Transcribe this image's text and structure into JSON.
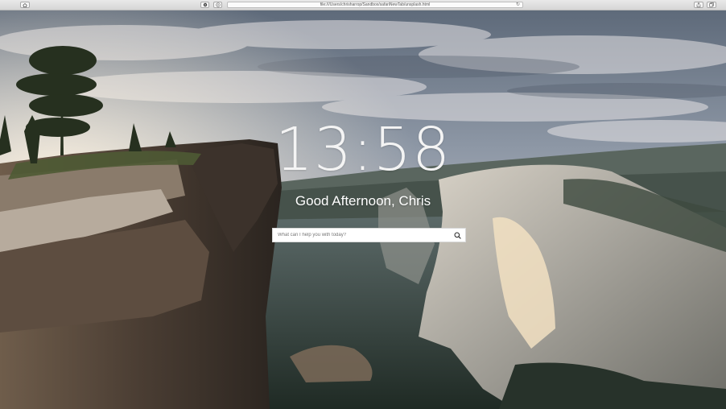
{
  "browser": {
    "url": "file:///Users/chrisharrop/Sandbox/safariNewTab/unsplash.html",
    "icons": {
      "home": "home-icon",
      "settings": "gear-icon",
      "extension": "compass-icon",
      "reload": "reload-icon",
      "share": "share-icon",
      "tabs": "tabs-icon"
    }
  },
  "page": {
    "time": "13:58",
    "greeting": "Good Afternoon, Chris",
    "search": {
      "value": "",
      "placeholder": "What can I help you with today?",
      "button_icon": "search-icon"
    }
  }
}
